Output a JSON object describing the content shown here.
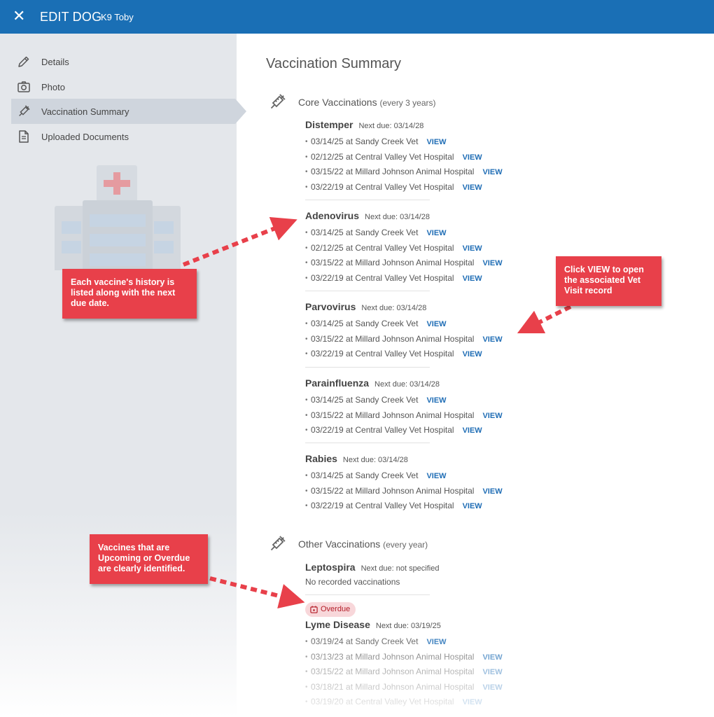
{
  "header": {
    "title": "EDIT DOG",
    "dog_name": "K9 Toby",
    "close_icon": "close-icon"
  },
  "sidebar": {
    "items": [
      {
        "label": "Details",
        "icon": "pencil-icon"
      },
      {
        "label": "Photo",
        "icon": "camera-icon"
      },
      {
        "label": "Vaccination Summary",
        "icon": "syringe-icon",
        "active": true
      },
      {
        "label": "Uploaded Documents",
        "icon": "document-icon"
      }
    ]
  },
  "main": {
    "title": "Vaccination Summary",
    "link_label": "VIEW",
    "core": {
      "label": "Core Vaccinations",
      "note": "(every 3 years)",
      "vaccines": [
        {
          "name": "Distemper",
          "next_due": "Next due: 03/14/28",
          "records": [
            "03/14/25 at Sandy Creek Vet",
            "02/12/25 at Central Valley Vet Hospital",
            "03/15/22 at Millard Johnson Animal Hospital",
            "03/22/19 at Central Valley Vet Hospital"
          ]
        },
        {
          "name": "Adenovirus",
          "next_due": "Next due: 03/14/28",
          "records": [
            "03/14/25 at Sandy Creek Vet",
            "02/12/25 at Central Valley Vet Hospital",
            "03/15/22 at Millard Johnson Animal Hospital",
            "03/22/19 at Central Valley Vet Hospital"
          ]
        },
        {
          "name": "Parvovirus",
          "next_due": "Next due: 03/14/28",
          "records": [
            "03/14/25 at Sandy Creek Vet",
            "03/15/22 at Millard Johnson Animal Hospital",
            "03/22/19 at Central Valley Vet Hospital"
          ]
        },
        {
          "name": "Parainfluenza",
          "next_due": "Next due: 03/14/28",
          "records": [
            "03/14/25 at Sandy Creek Vet",
            "03/15/22 at Millard Johnson Animal Hospital",
            "03/22/19 at Central Valley Vet Hospital"
          ]
        },
        {
          "name": "Rabies",
          "next_due": "Next due: 03/14/28",
          "records": [
            "03/14/25 at Sandy Creek Vet",
            "03/15/22 at Millard Johnson Animal Hospital",
            "03/22/19 at Central Valley Vet Hospital"
          ]
        }
      ]
    },
    "other": {
      "label": "Other Vaccinations",
      "note": "(every year)",
      "vaccines": [
        {
          "name": "Leptospira",
          "next_due": "Next due: not specified",
          "empty_text": "No recorded vaccinations"
        },
        {
          "name": "Lyme Disease",
          "next_due": "Next due: 03/19/25",
          "status": "Overdue",
          "records": [
            "03/19/24 at Sandy Creek Vet",
            "03/13/23 at Millard Johnson Animal Hospital",
            "03/15/22 at Millard Johnson Animal Hospital",
            "03/18/21 at Millard Johnson Animal Hospital",
            "03/19/20 at Central Valley Vet Hospital"
          ]
        }
      ]
    }
  },
  "callouts": {
    "history": "Each vaccine's history is listed along with the next due date.",
    "view": "Click VIEW to open the associated Vet Visit record",
    "overdue": "Vaccines that are Upcoming or Overdue are clearly identified."
  },
  "colors": {
    "header": "#1a6fb5",
    "sidebar": "#e4e7eb",
    "link": "#1f6db5",
    "callout": "#e8404a",
    "overdue_bg": "#f8d7da",
    "overdue_text": "#b31d28"
  }
}
